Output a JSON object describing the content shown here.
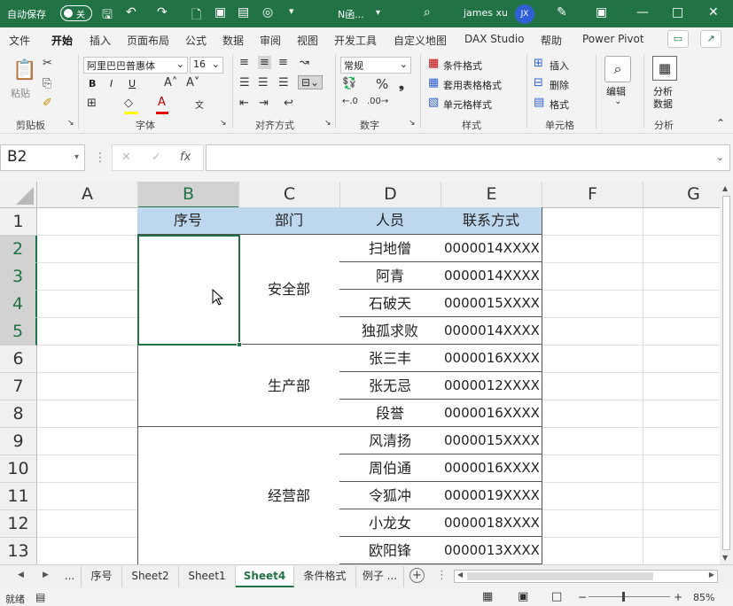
{
  "titlebar": {
    "autosave_label": "自动保存",
    "autosave_state": "关",
    "doc_name": "N函...",
    "user_name": "james xu",
    "user_initials": "JX"
  },
  "menu_tabs": [
    "文件",
    "开始",
    "插入",
    "页面布局",
    "公式",
    "数据",
    "审阅",
    "视图",
    "开发工具",
    "自定义地图",
    "DAX Studio",
    "帮助",
    "Power Pivot"
  ],
  "active_tab": "开始",
  "ribbon": {
    "clipboard": {
      "paste_label": "粘贴",
      "group_label": "剪贴板"
    },
    "font": {
      "family": "阿里巴巴普惠体",
      "size": "16",
      "group_label": "字体",
      "bold": "B",
      "italic": "I",
      "underline": "U"
    },
    "alignment": {
      "group_label": "对齐方式"
    },
    "number": {
      "format": "常规",
      "group_label": "数字"
    },
    "styles": {
      "cond_format": "条件格式",
      "table_format": "套用表格格式",
      "cell_style": "单元格样式",
      "group_label": "样式"
    },
    "cells": {
      "insert": "插入",
      "delete": "删除",
      "format": "格式",
      "group_label": "单元格"
    },
    "editing": {
      "label": "编辑"
    },
    "analysis": {
      "label1": "分析",
      "label2": "数据",
      "group_label": "分析"
    }
  },
  "formula_bar": {
    "name_box": "B2",
    "fx_label": "fx",
    "formula": ""
  },
  "sheet": {
    "columns": [
      "A",
      "B",
      "C",
      "D",
      "E",
      "F",
      "G"
    ],
    "rows": [
      "1",
      "2",
      "3",
      "4",
      "5",
      "6",
      "7",
      "8",
      "9",
      "10",
      "11",
      "12",
      "13"
    ],
    "selected_cell": "B2",
    "headers": [
      "序号",
      "部门",
      "人员",
      "联系方式"
    ],
    "departments": [
      "安全部",
      "生产部",
      "经营部"
    ],
    "people": [
      {
        "name": "扫地僧",
        "phone": "0000014XXXX"
      },
      {
        "name": "阿青",
        "phone": "0000014XXXX"
      },
      {
        "name": "石破天",
        "phone": "0000015XXXX"
      },
      {
        "name": "独孤求败",
        "phone": "0000014XXXX"
      },
      {
        "name": "张三丰",
        "phone": "0000016XXXX"
      },
      {
        "name": "张无忌",
        "phone": "0000012XXXX"
      },
      {
        "name": "段誉",
        "phone": "0000016XXXX"
      },
      {
        "name": "风清扬",
        "phone": "0000015XXXX"
      },
      {
        "name": "周伯通",
        "phone": "0000016XXXX"
      },
      {
        "name": "令狐冲",
        "phone": "0000019XXXX"
      },
      {
        "name": "小龙女",
        "phone": "0000018XXXX"
      },
      {
        "name": "欧阳锋",
        "phone": "0000013XXXX"
      }
    ]
  },
  "sheet_tabs": [
    "...",
    "序号",
    "Sheet2",
    "Sheet1",
    "Sheet4",
    "条件格式",
    "例子 ..."
  ],
  "active_sheet": "Sheet4",
  "status": {
    "ready": "就绪",
    "zoom": "85%"
  }
}
